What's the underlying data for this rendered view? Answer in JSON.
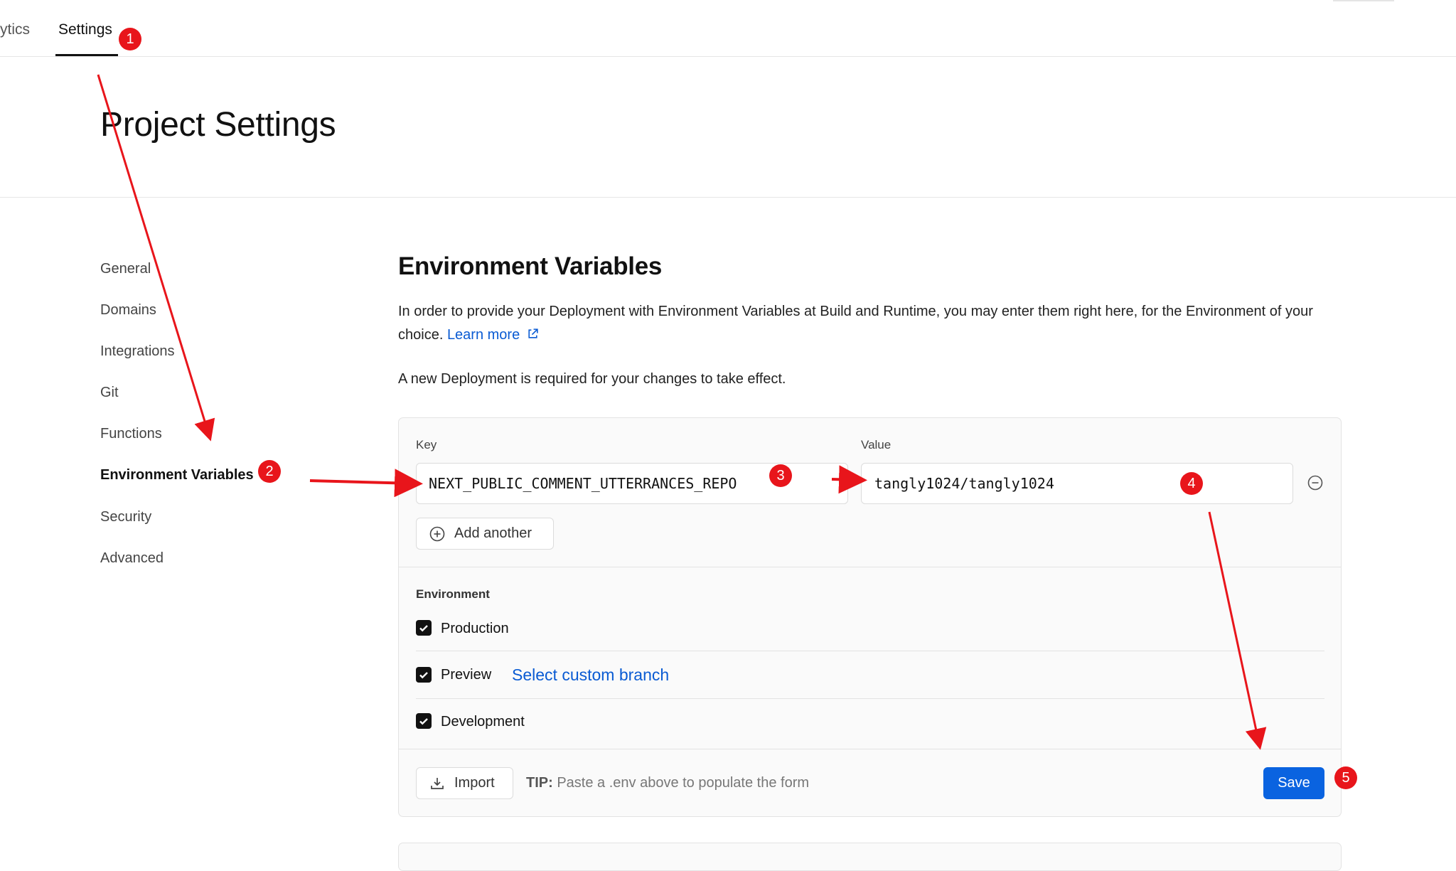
{
  "nav": {
    "tabs": [
      {
        "label": "ytics"
      },
      {
        "label": "Settings"
      }
    ]
  },
  "page": {
    "title": "Project Settings"
  },
  "sidebar": {
    "items": [
      {
        "label": "General"
      },
      {
        "label": "Domains"
      },
      {
        "label": "Integrations"
      },
      {
        "label": "Git"
      },
      {
        "label": "Functions"
      },
      {
        "label": "Environment Variables"
      },
      {
        "label": "Security"
      },
      {
        "label": "Advanced"
      }
    ]
  },
  "env": {
    "title": "Environment Variables",
    "description": "In order to provide your Deployment with Environment Variables at Build and Runtime, you may enter them right here, for the Environment of your choice.",
    "learn_more": "Learn more",
    "notice": "A new Deployment is required for your changes to take effect.",
    "key_label": "Key",
    "value_label": "Value",
    "key_value": "NEXT_PUBLIC_COMMENT_UTTERRANCES_REPO",
    "value_value": "tangly1024/tangly1024",
    "add_another": "Add another",
    "environment_label": "Environment",
    "environments": [
      {
        "label": "Production",
        "checked": true
      },
      {
        "label": "Preview",
        "checked": true
      },
      {
        "label": "Development",
        "checked": true
      }
    ],
    "custom_branch": "Select custom branch",
    "import_label": "Import",
    "tip_prefix": "TIP:",
    "tip_text": " Paste a .env above to populate the form",
    "save_label": "Save"
  },
  "annotations": {
    "badges": [
      "1",
      "2",
      "3",
      "4",
      "5"
    ],
    "color": "#e8151b"
  }
}
